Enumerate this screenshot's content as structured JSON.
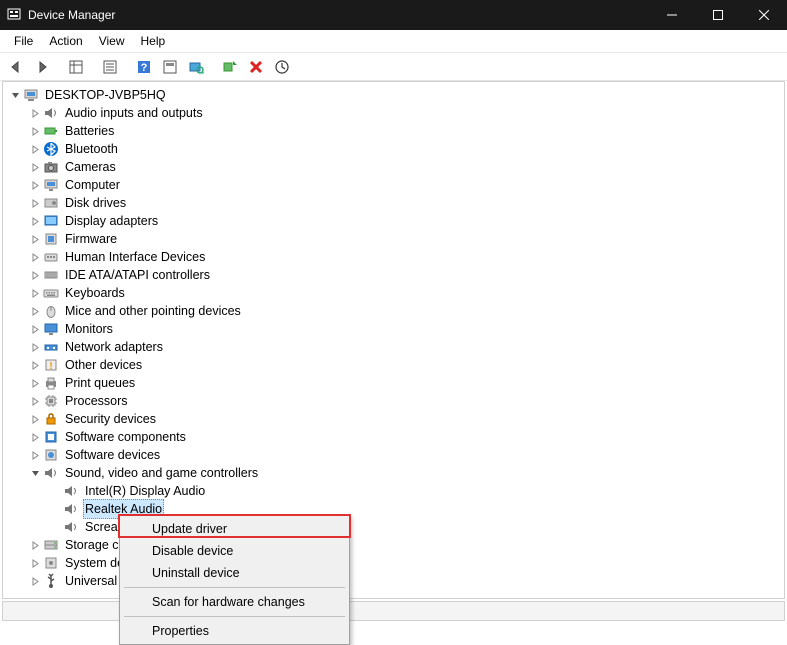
{
  "window": {
    "title": "Device Manager"
  },
  "menu": {
    "file": "File",
    "action": "Action",
    "view": "View",
    "help": "Help"
  },
  "tree": {
    "root": "DESKTOP-JVBP5HQ",
    "categories": [
      {
        "label": "Audio inputs and outputs",
        "icon": "speaker"
      },
      {
        "label": "Batteries",
        "icon": "battery"
      },
      {
        "label": "Bluetooth",
        "icon": "bluetooth"
      },
      {
        "label": "Cameras",
        "icon": "camera"
      },
      {
        "label": "Computer",
        "icon": "computer"
      },
      {
        "label": "Disk drives",
        "icon": "disk"
      },
      {
        "label": "Display adapters",
        "icon": "display"
      },
      {
        "label": "Firmware",
        "icon": "firmware"
      },
      {
        "label": "Human Interface Devices",
        "icon": "hid"
      },
      {
        "label": "IDE ATA/ATAPI controllers",
        "icon": "ide"
      },
      {
        "label": "Keyboards",
        "icon": "keyboard"
      },
      {
        "label": "Mice and other pointing devices",
        "icon": "mouse"
      },
      {
        "label": "Monitors",
        "icon": "monitor"
      },
      {
        "label": "Network adapters",
        "icon": "network"
      },
      {
        "label": "Other devices",
        "icon": "other"
      },
      {
        "label": "Print queues",
        "icon": "printer"
      },
      {
        "label": "Processors",
        "icon": "cpu"
      },
      {
        "label": "Security devices",
        "icon": "security"
      },
      {
        "label": "Software components",
        "icon": "swcomp"
      },
      {
        "label": "Software devices",
        "icon": "swdev"
      }
    ],
    "sound": {
      "label": "Sound, video and game controllers",
      "children": [
        "Intel(R) Display Audio",
        "Realtek Audio",
        "Screa"
      ]
    },
    "after": [
      {
        "label": "Storage c",
        "icon": "storage"
      },
      {
        "label": "System de",
        "icon": "system"
      },
      {
        "label": "Universal",
        "icon": "usb"
      }
    ]
  },
  "context_menu": {
    "items": [
      "Update driver",
      "Disable device",
      "Uninstall device",
      "Scan for hardware changes",
      "Properties"
    ]
  }
}
